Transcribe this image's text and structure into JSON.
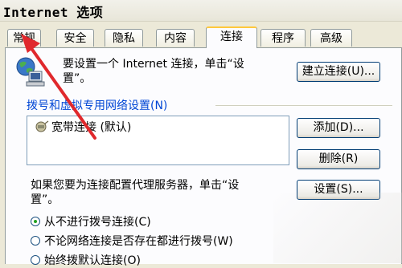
{
  "window": {
    "title": "Internet 选项"
  },
  "tabs": [
    {
      "label": "常规"
    },
    {
      "label": "安全"
    },
    {
      "label": "隐私"
    },
    {
      "label": "内容"
    },
    {
      "label": "连接",
      "active": true
    },
    {
      "label": "程序"
    },
    {
      "label": "高级"
    }
  ],
  "setup": {
    "text_line1": "要设置一个 Internet 连接，单击“设",
    "text_line2": "置”。",
    "button_label": "建立连接(U)..."
  },
  "dialup": {
    "group_label": "拨号和虚拟专用网络设置(N)",
    "connections": [
      {
        "label": "宽带连接 (默认)"
      }
    ],
    "add_label": "添加(D)...",
    "remove_label": "删除(R)",
    "settings_label": "设置(S)..."
  },
  "proxy": {
    "text_line1": "如果您要为连接配置代理服务器，单击“设",
    "text_line2": "置”。"
  },
  "radios": [
    {
      "label": "从不进行拨号连接(C)",
      "checked": true
    },
    {
      "label": "不论网络连接是否存在都进行拨号(W)",
      "checked": false
    },
    {
      "label": "始终拨默认连接(O)",
      "checked": false
    }
  ],
  "colors": {
    "arrow": "#e0282c",
    "group_label": "#0046d5",
    "active_tab_accent": "#ffc83c"
  }
}
